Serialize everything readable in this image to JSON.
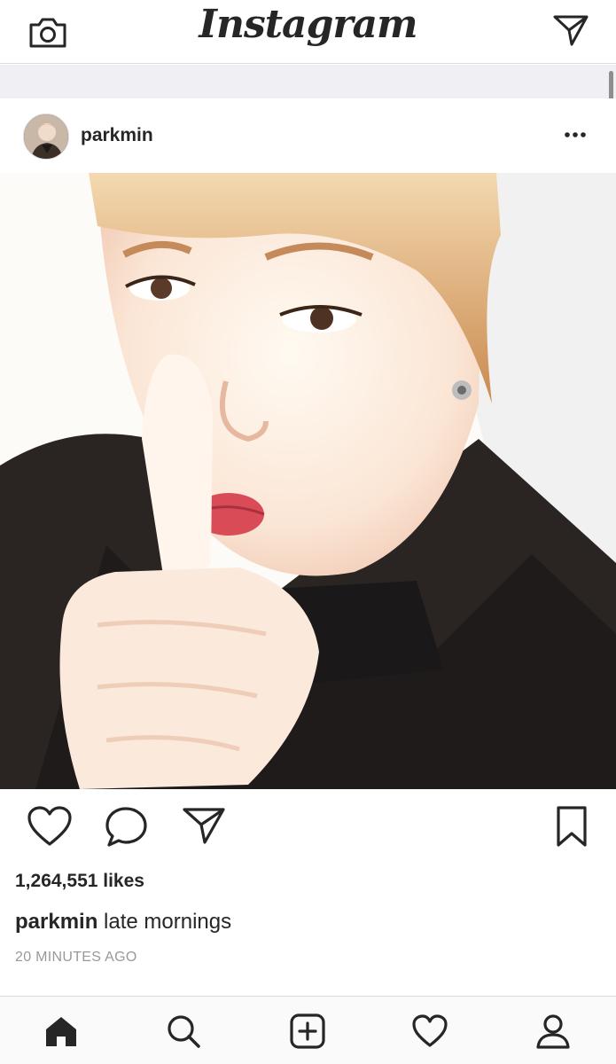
{
  "header": {
    "logo": "Instagram",
    "camera_icon": "camera-icon",
    "direct_icon": "direct-message-icon"
  },
  "post": {
    "username": "parkmin",
    "more_icon": "more-options-icon",
    "photo": "selfie photo",
    "likes": "1,264,551 likes",
    "caption_user": "parkmin",
    "caption_text": "late mornings",
    "timestamp": "20 MINUTES AGO"
  },
  "actions": {
    "like_icon": "heart-icon",
    "comment_icon": "comment-icon",
    "share_icon": "share-icon",
    "save_icon": "bookmark-icon"
  },
  "tabbar": {
    "items": [
      "home-icon",
      "search-icon",
      "add-post-icon",
      "activity-heart-icon",
      "profile-icon"
    ]
  },
  "colors": {
    "text": "#262626",
    "muted": "#999999",
    "divider": "#dbdbdb",
    "band": "#efeff4"
  }
}
